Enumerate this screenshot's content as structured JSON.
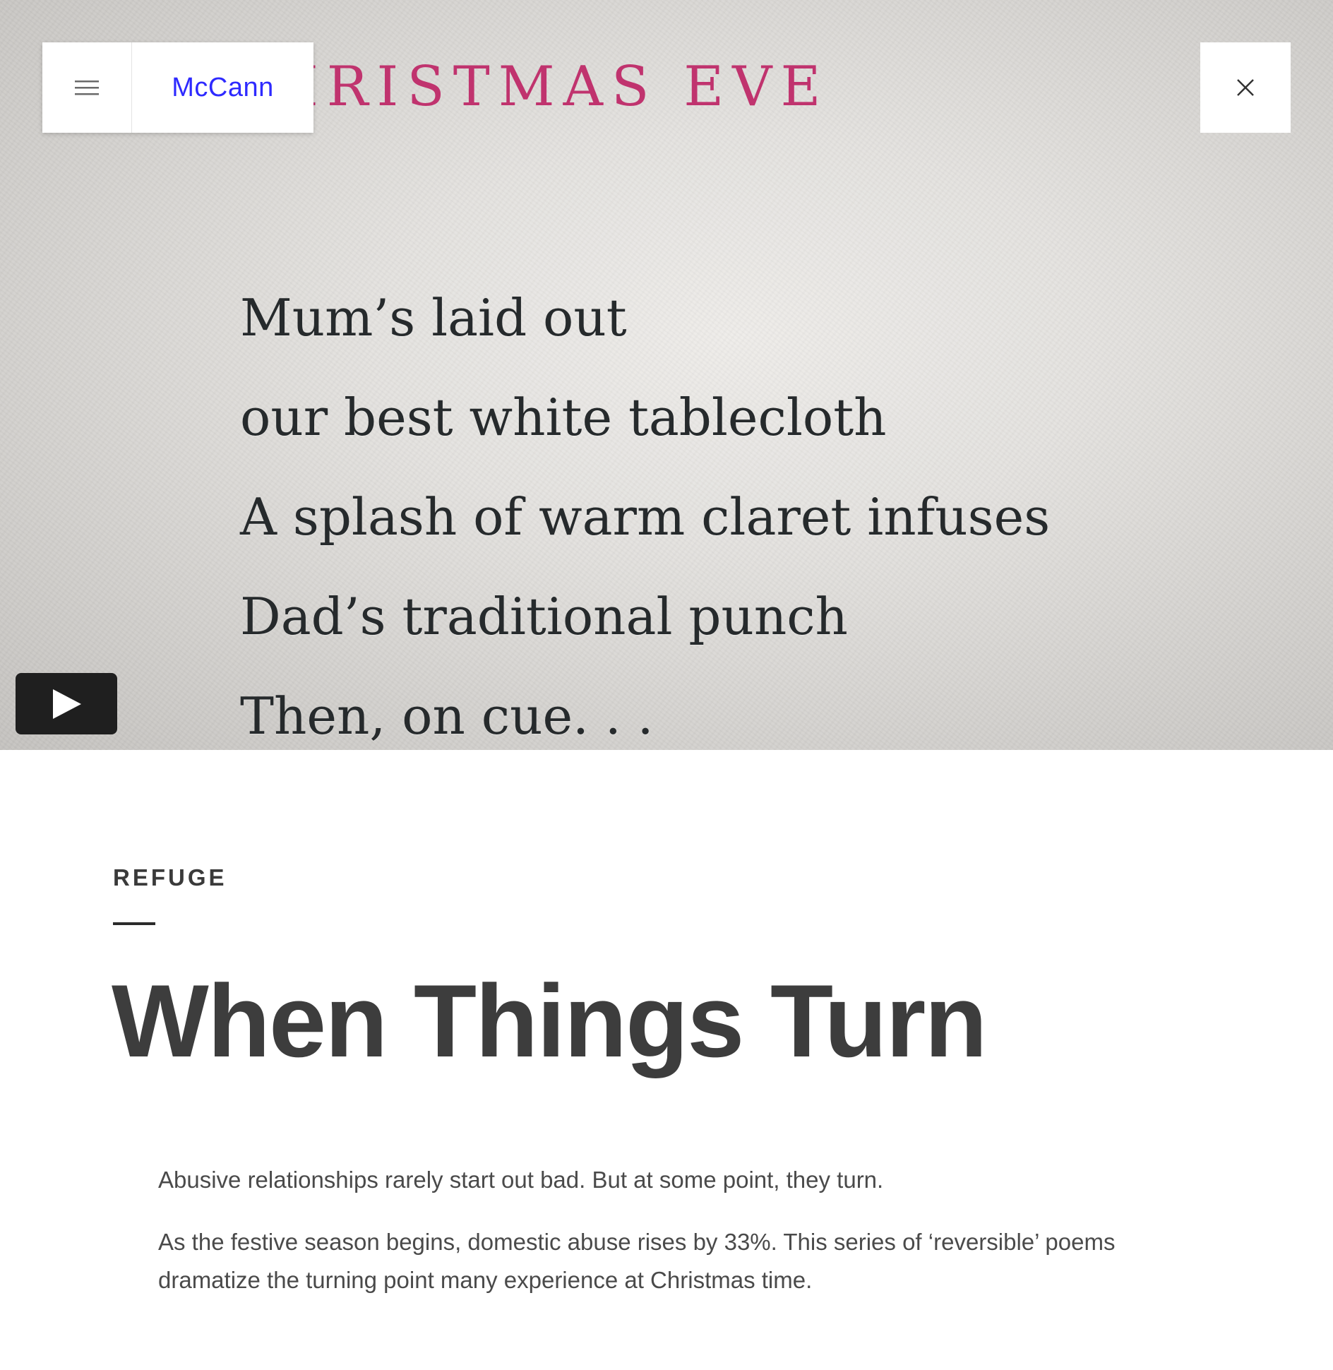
{
  "header": {
    "logo_text": "McCann",
    "menu_icon": "hamburger-icon",
    "close_icon": "close-icon",
    "logo_color": "#2e2aff"
  },
  "video": {
    "heading_partial": "IRISTMAS EVE",
    "heading_color": "#c0336e",
    "poem_lines": [
      "Mum’s laid out",
      "our best white tablecloth",
      "A splash of warm claret infuses",
      "Dad’s traditional punch",
      "Then, on cue. . ."
    ],
    "play_icon": "play-icon"
  },
  "article": {
    "client": "REFUGE",
    "title": "When Things Turn",
    "paragraphs": [
      "Abusive relationships rarely start out bad. But at some point, they turn.",
      "As the festive season begins, domestic abuse rises by 33%. This series of ‘reversible’ poems dramatize the turning point many experience at Christmas time."
    ]
  }
}
